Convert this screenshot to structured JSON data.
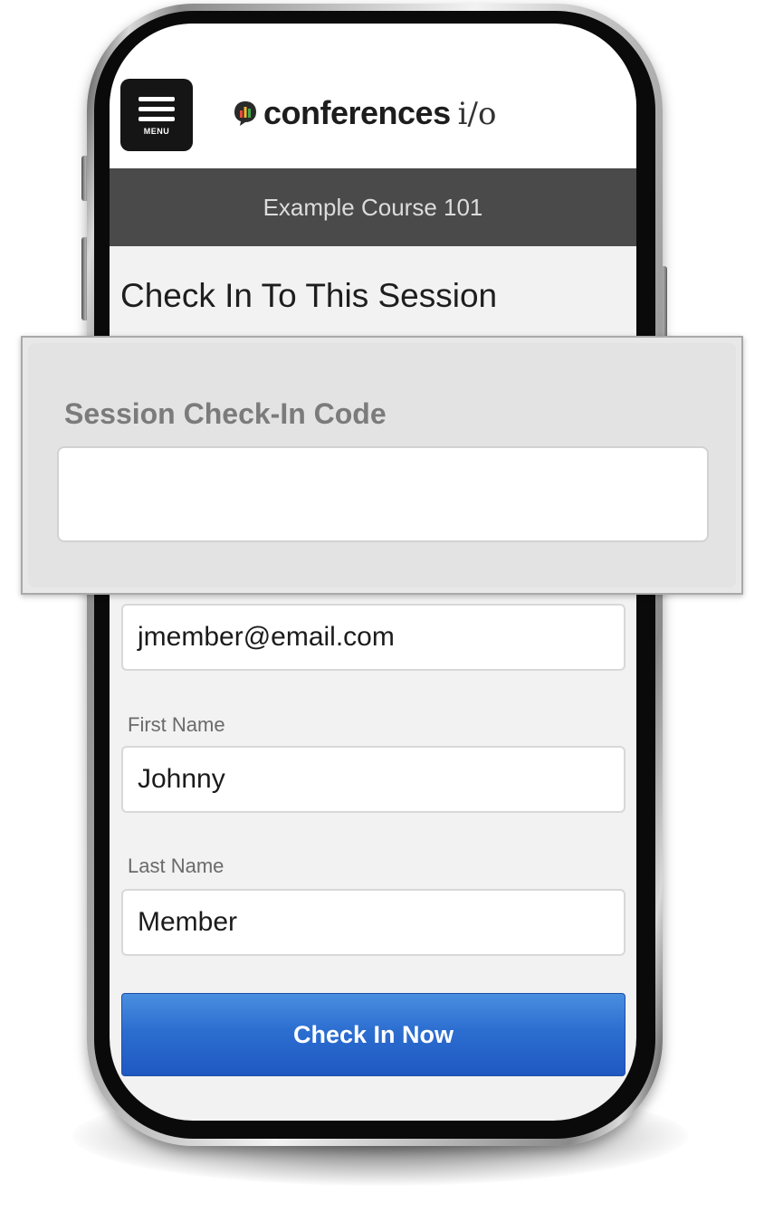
{
  "header": {
    "menu_label": "MENU",
    "logo_brand": "conferences",
    "logo_suffix": "i/o"
  },
  "course_bar": {
    "title": "Example Course 101"
  },
  "page": {
    "title": "Check In To This Session"
  },
  "checkin_code": {
    "label": "Session Check-In Code",
    "value": ""
  },
  "form": {
    "email": {
      "value": "jmember@email.com"
    },
    "first_name": {
      "label": "First Name",
      "value": "Johnny"
    },
    "last_name": {
      "label": "Last Name",
      "value": "Member"
    },
    "submit_label": "Check In Now"
  },
  "icons": {
    "menu": "hamburger-icon",
    "logo": "speech-bubble-chart-icon"
  },
  "colors": {
    "course_bar": "#4a4a4a",
    "button": "#2c6ed0",
    "menu_button": "#151515"
  }
}
